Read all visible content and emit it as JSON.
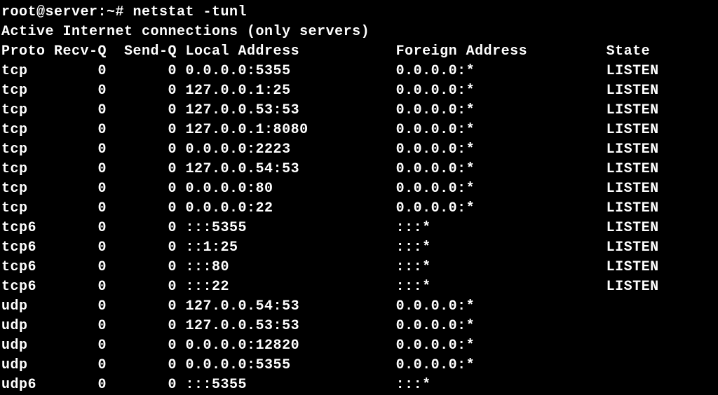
{
  "prompt": "root@server:~# netstat -tunl",
  "subtitle": "Active Internet connections (only servers)",
  "headers": {
    "proto": "Proto",
    "recvq": "Recv-Q",
    "sendq": "Send-Q",
    "local": "Local Address",
    "foreign": "Foreign Address",
    "state": "State"
  },
  "rows": [
    {
      "proto": "tcp",
      "recvq": "0",
      "sendq": "0",
      "local": "0.0.0.0:5355",
      "foreign": "0.0.0.0:*",
      "state": "LISTEN"
    },
    {
      "proto": "tcp",
      "recvq": "0",
      "sendq": "0",
      "local": "127.0.0.1:25",
      "foreign": "0.0.0.0:*",
      "state": "LISTEN"
    },
    {
      "proto": "tcp",
      "recvq": "0",
      "sendq": "0",
      "local": "127.0.0.53:53",
      "foreign": "0.0.0.0:*",
      "state": "LISTEN"
    },
    {
      "proto": "tcp",
      "recvq": "0",
      "sendq": "0",
      "local": "127.0.0.1:8080",
      "foreign": "0.0.0.0:*",
      "state": "LISTEN"
    },
    {
      "proto": "tcp",
      "recvq": "0",
      "sendq": "0",
      "local": "0.0.0.0:2223",
      "foreign": "0.0.0.0:*",
      "state": "LISTEN"
    },
    {
      "proto": "tcp",
      "recvq": "0",
      "sendq": "0",
      "local": "127.0.0.54:53",
      "foreign": "0.0.0.0:*",
      "state": "LISTEN"
    },
    {
      "proto": "tcp",
      "recvq": "0",
      "sendq": "0",
      "local": "0.0.0.0:80",
      "foreign": "0.0.0.0:*",
      "state": "LISTEN"
    },
    {
      "proto": "tcp",
      "recvq": "0",
      "sendq": "0",
      "local": "0.0.0.0:22",
      "foreign": "0.0.0.0:*",
      "state": "LISTEN"
    },
    {
      "proto": "tcp6",
      "recvq": "0",
      "sendq": "0",
      "local": ":::5355",
      "foreign": ":::*",
      "state": "LISTEN"
    },
    {
      "proto": "tcp6",
      "recvq": "0",
      "sendq": "0",
      "local": "::1:25",
      "foreign": ":::*",
      "state": "LISTEN"
    },
    {
      "proto": "tcp6",
      "recvq": "0",
      "sendq": "0",
      "local": ":::80",
      "foreign": ":::*",
      "state": "LISTEN"
    },
    {
      "proto": "tcp6",
      "recvq": "0",
      "sendq": "0",
      "local": ":::22",
      "foreign": ":::*",
      "state": "LISTEN"
    },
    {
      "proto": "udp",
      "recvq": "0",
      "sendq": "0",
      "local": "127.0.0.54:53",
      "foreign": "0.0.0.0:*",
      "state": ""
    },
    {
      "proto": "udp",
      "recvq": "0",
      "sendq": "0",
      "local": "127.0.0.53:53",
      "foreign": "0.0.0.0:*",
      "state": ""
    },
    {
      "proto": "udp",
      "recvq": "0",
      "sendq": "0",
      "local": "0.0.0.0:12820",
      "foreign": "0.0.0.0:*",
      "state": ""
    },
    {
      "proto": "udp",
      "recvq": "0",
      "sendq": "0",
      "local": "0.0.0.0:5355",
      "foreign": "0.0.0.0:*",
      "state": ""
    },
    {
      "proto": "udp6",
      "recvq": "0",
      "sendq": "0",
      "local": ":::5355",
      "foreign": ":::*",
      "state": ""
    }
  ]
}
